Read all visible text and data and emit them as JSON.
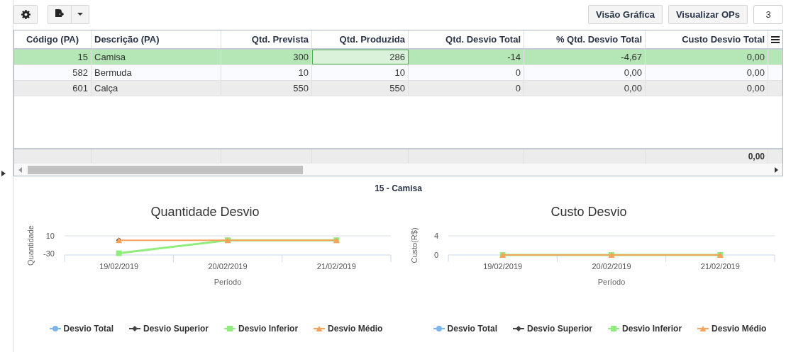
{
  "toolbar": {
    "right_buttons": [
      "Visão Gráfica",
      "Visualizar OPs"
    ],
    "count": "3"
  },
  "table": {
    "columns": [
      "Código (PA)",
      "Descrição (PA)",
      "Qtd. Prevista",
      "Qtd. Produzida",
      "Qtd. Desvio Total",
      "% Qtd. Desvio Total",
      "Custo Desvio Total"
    ],
    "rows": [
      {
        "selected": true,
        "cells": [
          {
            "text": "15",
            "focused": false
          },
          {
            "text": "Camisa",
            "focused": false
          },
          {
            "text": "300",
            "focused": false
          },
          {
            "text": "286",
            "focused": true
          },
          {
            "text": "-14",
            "focused": false
          },
          {
            "text": "-4,67",
            "focused": false
          },
          {
            "text": "0,00",
            "focused": false
          }
        ]
      },
      {
        "selected": false,
        "cells": [
          {
            "text": "582",
            "focused": false
          },
          {
            "text": "Bermuda",
            "focused": false
          },
          {
            "text": "10",
            "focused": false
          },
          {
            "text": "10",
            "focused": false
          },
          {
            "text": "0",
            "focused": false
          },
          {
            "text": "0,00",
            "focused": false
          },
          {
            "text": "0,00",
            "focused": false
          }
        ]
      },
      {
        "selected": false,
        "cells": [
          {
            "text": "601",
            "focused": false
          },
          {
            "text": "Calça",
            "focused": false
          },
          {
            "text": "550",
            "focused": false
          },
          {
            "text": "550",
            "focused": false
          },
          {
            "text": "0",
            "focused": false
          },
          {
            "text": "0,00",
            "focused": false
          },
          {
            "text": "0,00",
            "focused": false
          }
        ]
      }
    ],
    "footer": {
      "total": "0,00"
    }
  },
  "section_title": "15 - Camisa",
  "charts": [
    {
      "chart_data": {
        "type": "line",
        "title": "Quantidade Desvio",
        "xlabel": "Período",
        "ylabel": "Quantidade",
        "categories": [
          "19/02/2019",
          "20/02/2019",
          "21/02/2019"
        ],
        "ylim": [
          -34,
          10
        ],
        "yticks": [
          {
            "value": -30,
            "label": "-30"
          },
          {
            "value": 10,
            "label": "10"
          }
        ],
        "legend": true,
        "series": [
          {
            "name": "Desvio Total",
            "color": "#7cb5ec",
            "marker": "circle",
            "values": [
              null,
              null,
              null
            ]
          },
          {
            "name": "Desvio Superior",
            "color": "#434348",
            "marker": "diamond",
            "values": [
              0,
              null,
              null
            ]
          },
          {
            "name": "Desvio Inferior",
            "color": "#90ed7d",
            "marker": "square",
            "values": [
              -30,
              0,
              0
            ]
          },
          {
            "name": "Desvio Médio",
            "color": "#f7a35c",
            "marker": "triangle",
            "values": [
              0,
              0,
              0
            ]
          }
        ]
      }
    },
    {
      "chart_data": {
        "type": "line",
        "title": "Custo Desvio",
        "xlabel": "Período",
        "ylabel": "Custo(R$)",
        "categories": [
          "19/02/2019",
          "20/02/2019",
          "21/02/2019"
        ],
        "ylim": [
          0,
          4
        ],
        "yticks": [
          {
            "value": 0,
            "label": "0"
          },
          {
            "value": 4,
            "label": "4"
          }
        ],
        "legend": true,
        "series": [
          {
            "name": "Desvio Total",
            "color": "#7cb5ec",
            "marker": "circle",
            "values": [
              null,
              null,
              null
            ]
          },
          {
            "name": "Desvio Superior",
            "color": "#434348",
            "marker": "diamond",
            "values": [
              null,
              null,
              null
            ]
          },
          {
            "name": "Desvio Inferior",
            "color": "#90ed7d",
            "marker": "square",
            "values": [
              0,
              0,
              0
            ]
          },
          {
            "name": "Desvio Médio",
            "color": "#f7a35c",
            "marker": "triangle",
            "values": [
              0,
              0,
              0
            ]
          }
        ]
      }
    }
  ]
}
